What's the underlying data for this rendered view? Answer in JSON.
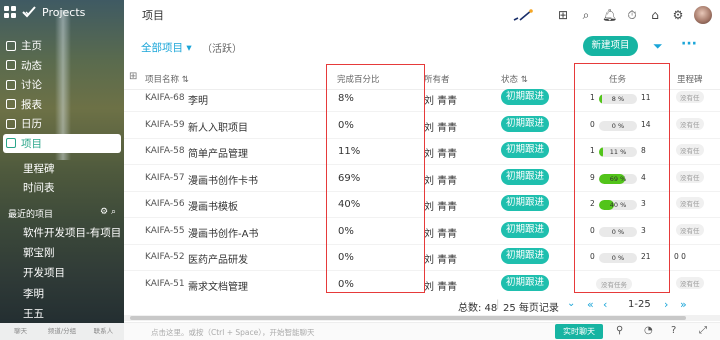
{
  "app": {
    "title": "Projects"
  },
  "sidebar": {
    "items": [
      {
        "label": "主页"
      },
      {
        "label": "动态"
      },
      {
        "label": "讨论"
      },
      {
        "label": "报表"
      },
      {
        "label": "日历"
      },
      {
        "label": "项目"
      }
    ],
    "subitems": [
      {
        "label": "里程碑"
      },
      {
        "label": "时间表"
      }
    ],
    "recent_title": "最近的项目",
    "recent": [
      {
        "label": "软件开发项目-有项目"
      },
      {
        "label": "郭宝刚"
      },
      {
        "label": "开发项目"
      },
      {
        "label": "李明"
      },
      {
        "label": "王五"
      }
    ],
    "bottom": [
      {
        "label": "聊天"
      },
      {
        "label": "频道/分组"
      },
      {
        "label": "联系人"
      }
    ]
  },
  "topbar": {
    "title": "项目"
  },
  "filter": {
    "view": "全部项目",
    "view_sub": "（活跃）",
    "new_button": "新建项目"
  },
  "table": {
    "headers": {
      "name": "项目名称",
      "percent": "完成百分比",
      "owner": "所有者",
      "status": "状态",
      "tasks": "任务",
      "milestone": "里程碑"
    },
    "rows": [
      {
        "key": "KAIFA-68",
        "name": "李明",
        "percent": "8%",
        "owner": "刘 青青",
        "status": "初期跟进",
        "task_left": "1",
        "task_pct": "8 %",
        "task_fill": 0.08,
        "task_right": "11",
        "milestone": "没有任"
      },
      {
        "key": "KAIFA-59",
        "name": "新人入职项目",
        "percent": "0%",
        "owner": "刘 青青",
        "status": "初期跟进",
        "task_left": "0",
        "task_pct": "0 %",
        "task_fill": 0,
        "task_right": "14",
        "milestone": "没有任"
      },
      {
        "key": "KAIFA-58",
        "name": "简单产品管理",
        "percent": "11%",
        "owner": "刘 青青",
        "status": "初期跟进",
        "task_left": "1",
        "task_pct": "11 %",
        "task_fill": 0.11,
        "task_right": "8",
        "milestone": "没有任"
      },
      {
        "key": "KAIFA-57",
        "name": "漫画书创作卡书",
        "percent": "69%",
        "owner": "刘 青青",
        "status": "初期跟进",
        "task_left": "9",
        "task_pct": "69 %",
        "task_fill": 0.69,
        "task_right": "4",
        "milestone": "没有任"
      },
      {
        "key": "KAIFA-56",
        "name": "漫画书模板",
        "percent": "40%",
        "owner": "刘 青青",
        "status": "初期跟进",
        "task_left": "2",
        "task_pct": "40 %",
        "task_fill": 0.4,
        "task_right": "3",
        "milestone": "没有任"
      },
      {
        "key": "KAIFA-55",
        "name": "漫画书创作-A书",
        "percent": "0%",
        "owner": "刘 青青",
        "status": "初期跟进",
        "task_left": "0",
        "task_pct": "0 %",
        "task_fill": 0,
        "task_right": "3",
        "milestone": "没有任"
      },
      {
        "key": "KAIFA-52",
        "name": "医药产品研发",
        "percent": "0%",
        "owner": "刘 青青",
        "status": "初期跟进",
        "task_left": "0",
        "task_pct": "0 %",
        "task_fill": 0,
        "task_right": "21",
        "milestone": "0 0"
      },
      {
        "key": "KAIFA-51",
        "name": "需求文档管理",
        "percent": "0%",
        "owner": "刘 青青",
        "status": "初期跟进",
        "task_none": "没有任务",
        "milestone": "没有任"
      }
    ]
  },
  "footer": {
    "total": "总数: 48",
    "page_size": "25 每页记录",
    "range": "1-25"
  },
  "chat": {
    "placeholder": "点击这里。或按（Ctrl + Space），开始智能聊天",
    "button": "实时聊天"
  },
  "colors": {
    "accent": "#16b4a2",
    "link": "#1aa5d8",
    "status": "#1fbfae",
    "highlight": "#e63a3a",
    "progress": "#52c41a"
  }
}
